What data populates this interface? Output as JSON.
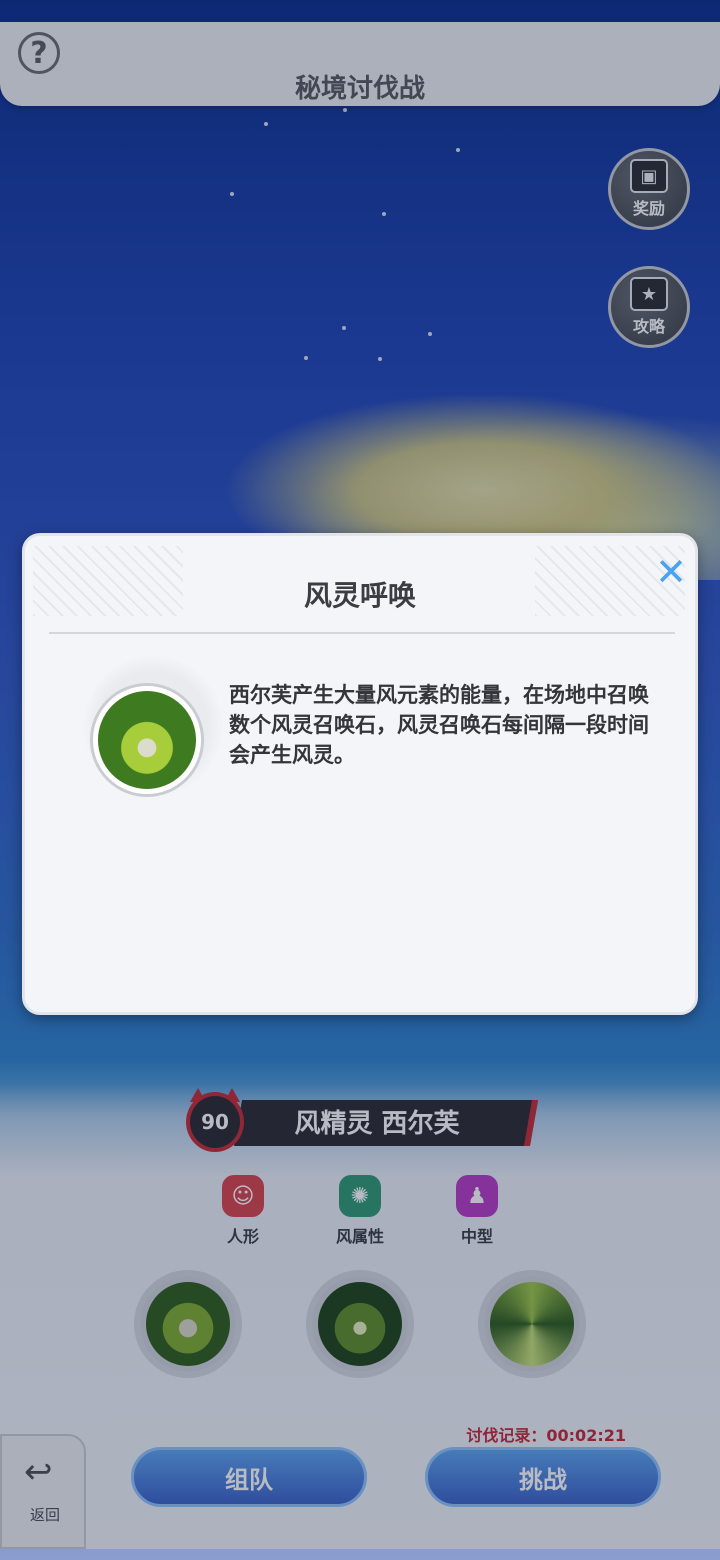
{
  "header": {
    "title": "秘境讨伐战",
    "help_symbol": "?"
  },
  "side_buttons": {
    "rewards_label": "奖励",
    "guide_label": "攻略"
  },
  "boss": {
    "level": "90",
    "name": "风精灵 西尔芙",
    "traits": [
      {
        "label": "人形",
        "icon": "humanoid-icon",
        "color": "#d9464e"
      },
      {
        "label": "风属性",
        "icon": "wind-element-icon",
        "color": "#2f9a73"
      },
      {
        "label": "中型",
        "icon": "medium-size-icon",
        "color": "#b63bc4"
      }
    ],
    "skills": [
      "wind-summon-skill-icon",
      "wind-vortex-skill-icon",
      "wind-spiral-skill-icon"
    ]
  },
  "record": {
    "label": "讨伐记录：00:02:21"
  },
  "actions": {
    "team_label": "组队",
    "challenge_label": "挑战",
    "back_label": "返回"
  },
  "modal": {
    "title": "风灵呼唤",
    "close_symbol": "✕",
    "description": "西尔芙产生大量风元素的能量，在场地中召唤数个风灵召唤石，风灵召唤石每间隔一段时间会产生风灵。"
  },
  "colors": {
    "accent_blue": "#4aa3f2",
    "danger_red": "#c7283a",
    "modal_bg": "#f4f5f8"
  }
}
